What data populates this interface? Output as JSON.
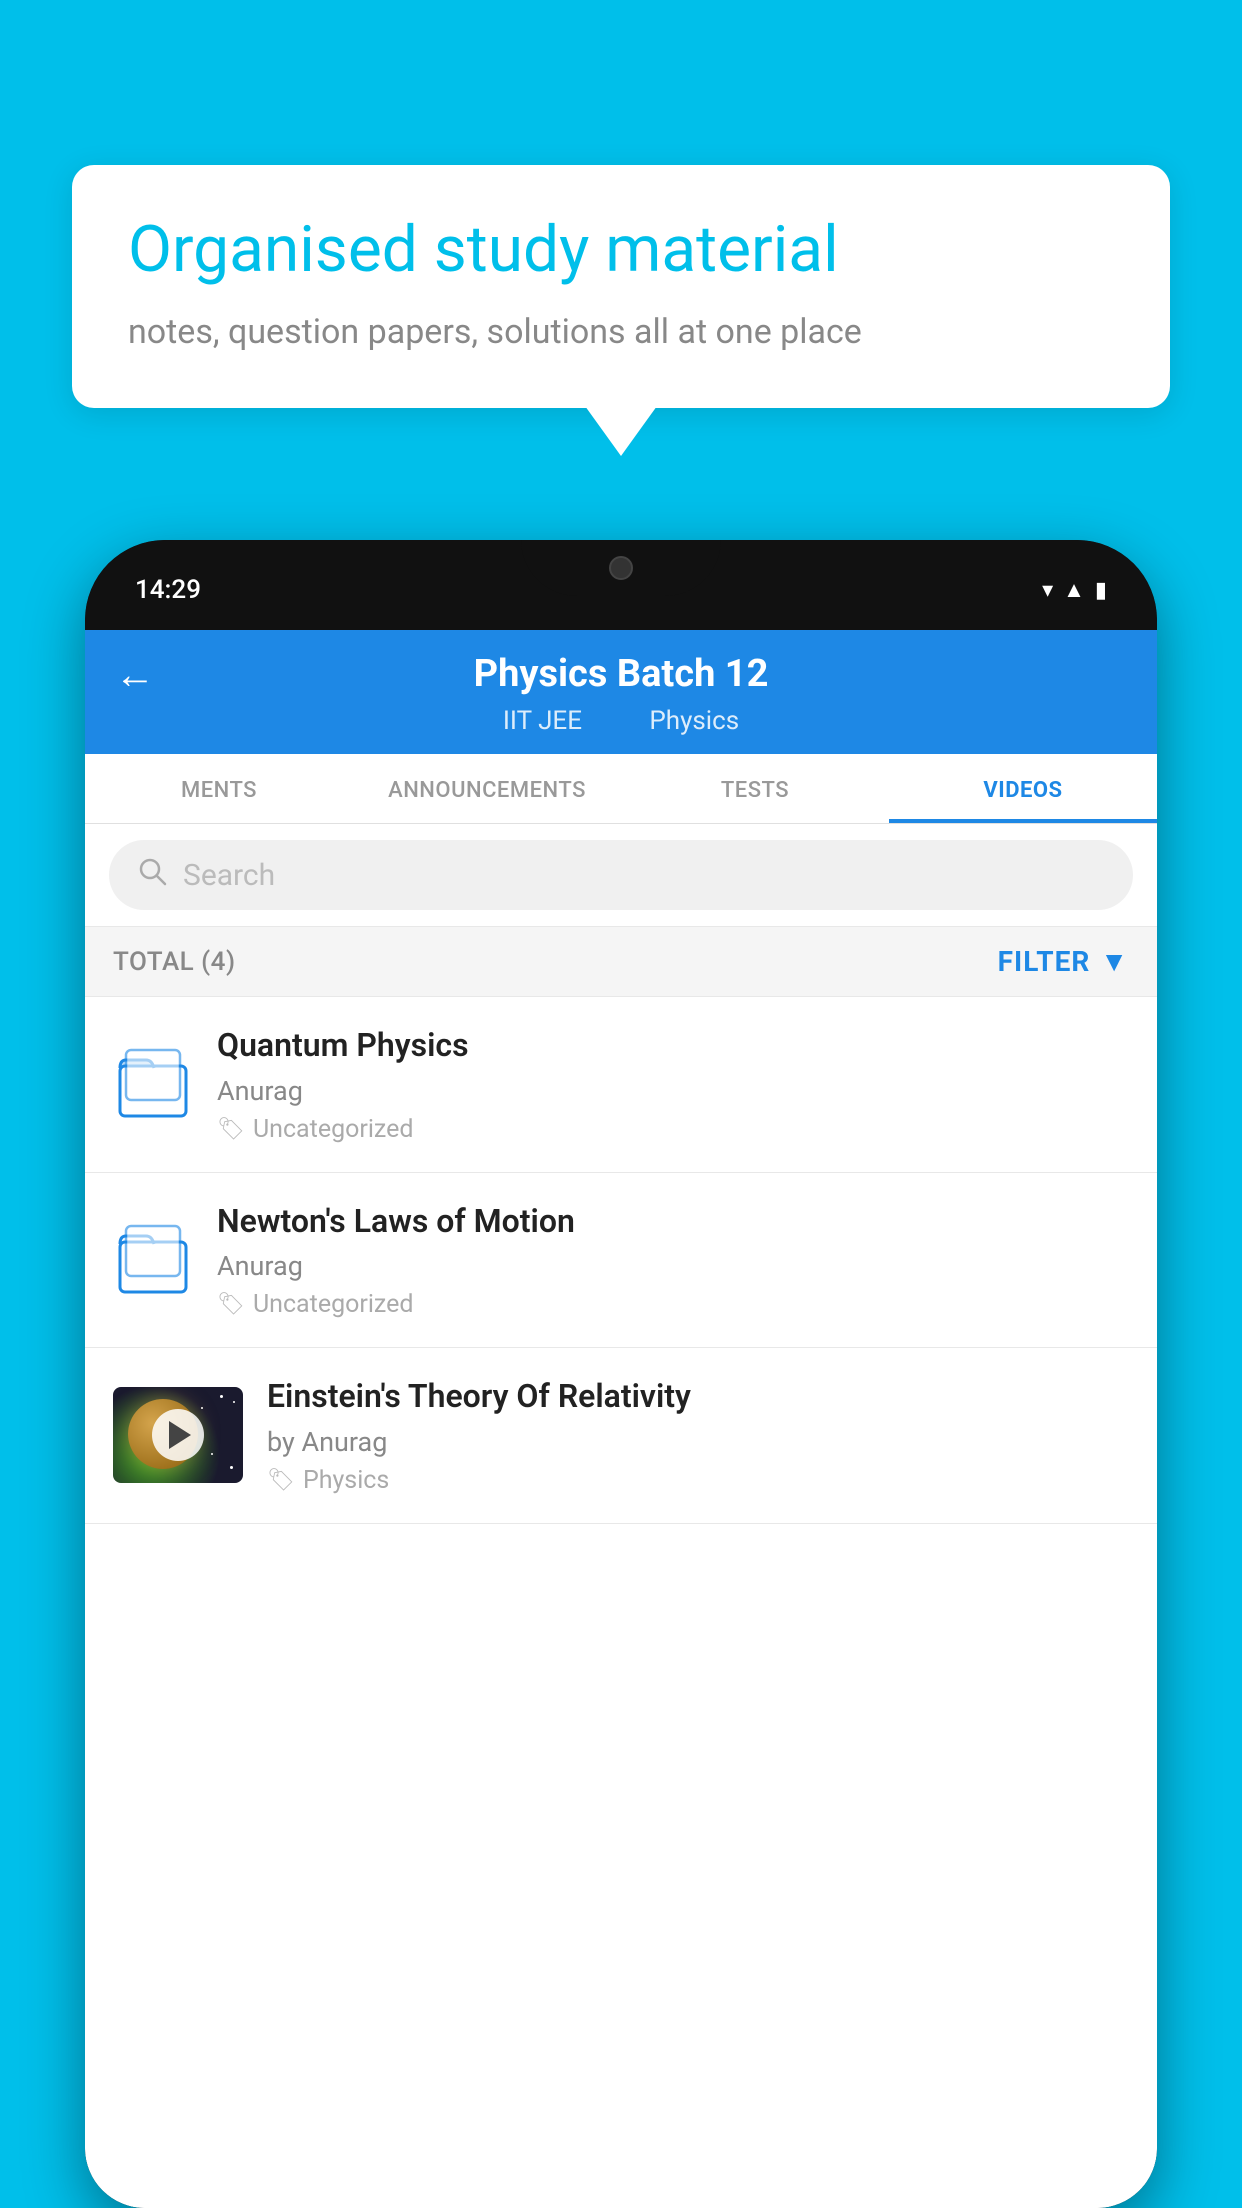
{
  "background": {
    "color": "#00BFEA"
  },
  "speech_bubble": {
    "title": "Organised study material",
    "subtitle": "notes, question papers, solutions all at one place"
  },
  "phone": {
    "status_bar": {
      "time": "14:29"
    },
    "header": {
      "back_label": "←",
      "title": "Physics Batch 12",
      "subtitle_part1": "IIT JEE",
      "subtitle_part2": "Physics"
    },
    "tabs": [
      {
        "label": "MENTS",
        "active": false
      },
      {
        "label": "ANNOUNCEMENTS",
        "active": false
      },
      {
        "label": "TESTS",
        "active": false
      },
      {
        "label": "VIDEOS",
        "active": true
      }
    ],
    "search": {
      "placeholder": "Search"
    },
    "filter": {
      "total_label": "TOTAL (4)",
      "filter_label": "FILTER"
    },
    "videos": [
      {
        "id": 1,
        "title": "Quantum Physics",
        "author": "Anurag",
        "tag": "Uncategorized",
        "has_thumbnail": false
      },
      {
        "id": 2,
        "title": "Newton's Laws of Motion",
        "author": "Anurag",
        "tag": "Uncategorized",
        "has_thumbnail": false
      },
      {
        "id": 3,
        "title": "Einstein's Theory Of Relativity",
        "author": "by Anurag",
        "tag": "Physics",
        "has_thumbnail": true
      }
    ]
  }
}
